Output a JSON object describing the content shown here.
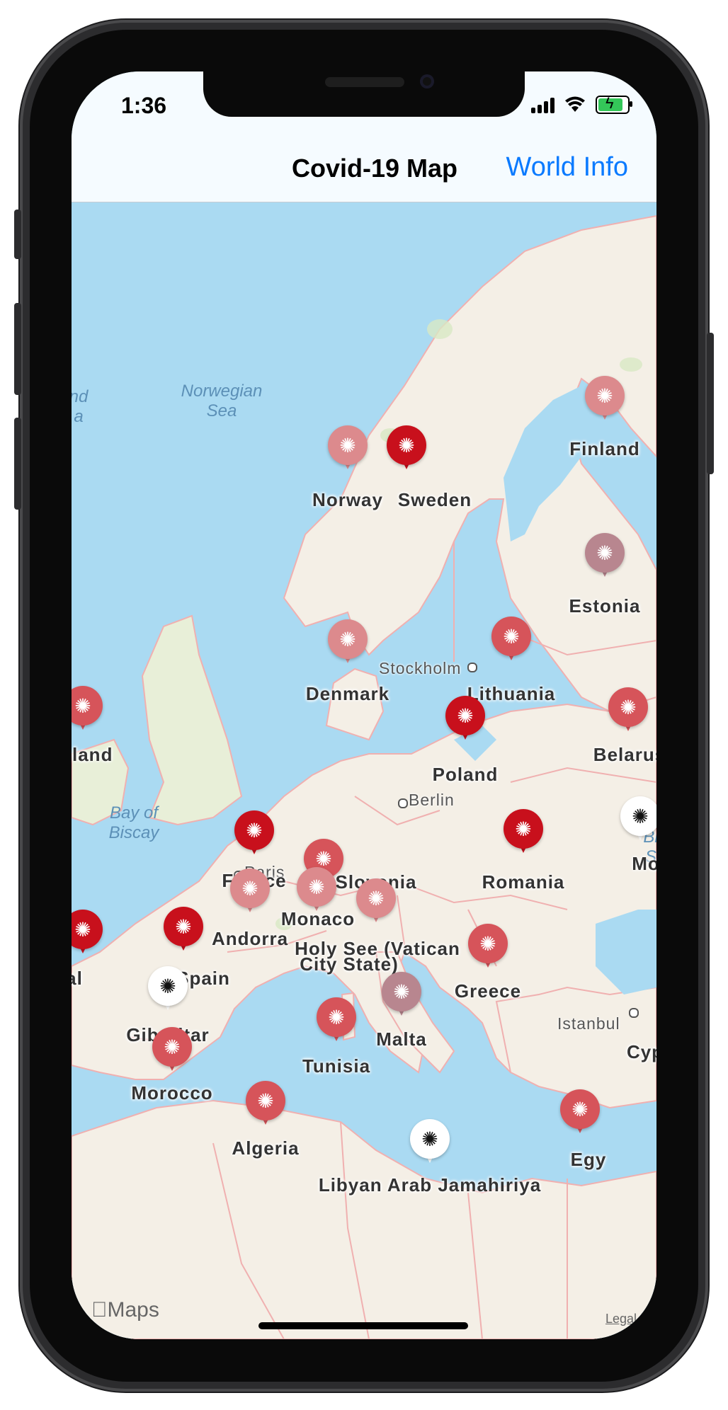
{
  "status_bar": {
    "time": "1:36"
  },
  "nav": {
    "title": "Covid-19 Map",
    "right_button": "World Info"
  },
  "map": {
    "seas": [
      {
        "id": "norwegian",
        "line1": "Norwegian",
        "line2": "Sea"
      },
      {
        "id": "biscay",
        "line1": "Bay of",
        "line2": "Biscay"
      },
      {
        "id": "left-edge",
        "line1": "nd",
        "line2": "a"
      },
      {
        "id": "right-edge",
        "line1": "Bl",
        "line2": "S"
      }
    ],
    "cities": [
      "Stockholm",
      "Berlin",
      "Paris",
      "Istanbul"
    ],
    "countries": [
      {
        "label": "Finland",
        "severity": "low"
      },
      {
        "label": "Norway",
        "severity": "low"
      },
      {
        "label": "Sweden",
        "severity": "high"
      },
      {
        "label": "Estonia",
        "severity": "minimal"
      },
      {
        "label": "Denmark",
        "severity": "low"
      },
      {
        "label": "Lithuania",
        "severity": "medium"
      },
      {
        "label": "eland",
        "severity": "medium"
      },
      {
        "label": "Belarus",
        "severity": "medium"
      },
      {
        "label": "Poland",
        "severity": "high"
      },
      {
        "label": "France",
        "severity": "high"
      },
      {
        "label": "Slovenia",
        "severity": "medium"
      },
      {
        "label": "Romania",
        "severity": "high"
      },
      {
        "label": "Mo",
        "severity": "none"
      },
      {
        "label": "Monaco",
        "severity": "low"
      },
      {
        "label": "Andorra",
        "severity": "low"
      },
      {
        "label": "Holy See (Vatican",
        "severity": "low"
      },
      {
        "label": "City State)",
        "severity": "none"
      },
      {
        "label": "al",
        "severity": "high"
      },
      {
        "label": "Spain",
        "severity": "high"
      },
      {
        "label": "Greece",
        "severity": "medium"
      },
      {
        "label": "Gibraltar",
        "severity": "none"
      },
      {
        "label": "Malta",
        "severity": "minimal"
      },
      {
        "label": "Cyp",
        "severity": "none"
      },
      {
        "label": "Tunisia",
        "severity": "medium"
      },
      {
        "label": "Morocco",
        "severity": "medium"
      },
      {
        "label": "Algeria",
        "severity": "medium"
      },
      {
        "label": "Egy",
        "severity": "medium"
      },
      {
        "label": "Libyan Arab Jamahiriya",
        "severity": "none"
      }
    ],
    "attribution": "Maps",
    "legal": "Legal"
  },
  "colors": {
    "high": "#c8101c",
    "medium": "#d6545a",
    "low": "#dc8a8d",
    "minimal": "#b8868f",
    "none": "#ffffff",
    "link": "#0a7aff"
  }
}
